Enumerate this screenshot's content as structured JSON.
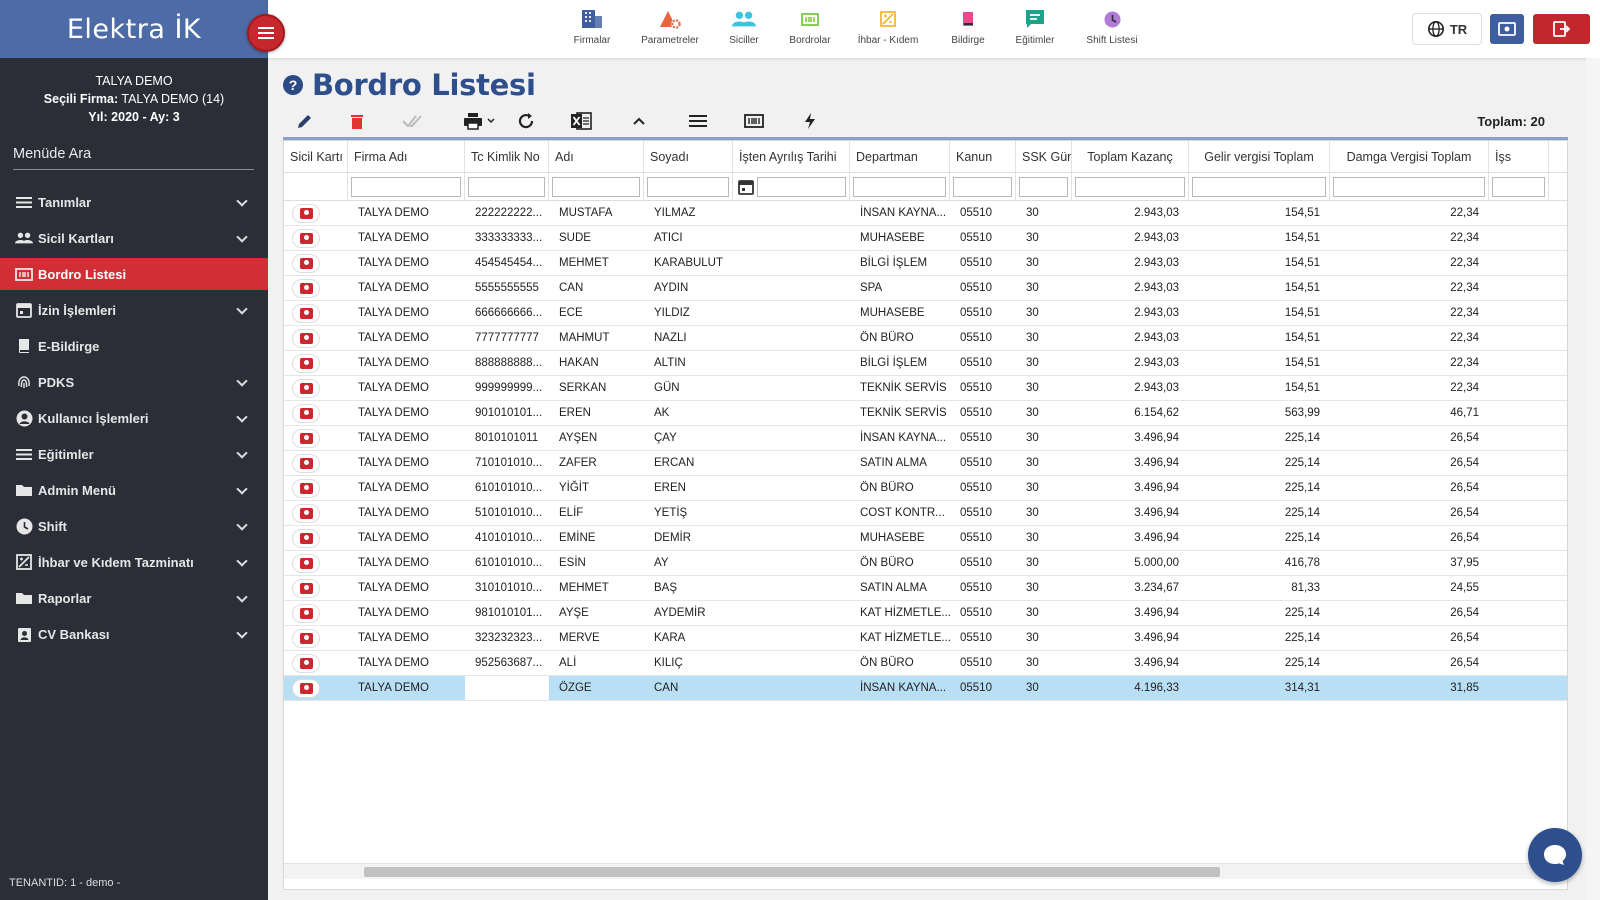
{
  "app": {
    "brand": "Elektra İK"
  },
  "company": {
    "name": "TALYA DEMO",
    "selected_label": "Seçili Firma:",
    "selected_value": "TALYA DEMO (14)",
    "period": "Yıl: 2020 - Ay: 3"
  },
  "sidebar": {
    "search_label": "Menüde Ara",
    "items": [
      {
        "label": "Tanımlar",
        "icon": "menu-icon"
      },
      {
        "label": "Sicil Kartları",
        "icon": "users-icon"
      },
      {
        "label": "Bordro Listesi",
        "icon": "payroll-icon"
      },
      {
        "label": "İzin İşlemleri",
        "icon": "calendar-icon"
      },
      {
        "label": "E-Bildirge",
        "icon": "book-icon"
      },
      {
        "label": "PDKS",
        "icon": "fingerprint-icon"
      },
      {
        "label": "Kullanıcı İşlemleri",
        "icon": "user-circle-icon"
      },
      {
        "label": "Eğitimler",
        "icon": "menu-icon"
      },
      {
        "label": "Admin Menü",
        "icon": "folder-icon"
      },
      {
        "label": "Shift",
        "icon": "clock-icon"
      },
      {
        "label": "İhbar ve Kıdem Tazminatı",
        "icon": "chart-box-icon"
      },
      {
        "label": "Raporlar",
        "icon": "folder-icon"
      },
      {
        "label": "CV Bankası",
        "icon": "badge-icon"
      }
    ],
    "tenant": "TENANTID: 1 - demo -"
  },
  "topbar": {
    "items": [
      {
        "label": "Firmalar",
        "icon": "building-icon",
        "color": "#3e5ea0"
      },
      {
        "label": "Parametreler",
        "icon": "shapes-icon",
        "color": "#e8663d"
      },
      {
        "label": "Siciller",
        "icon": "people-icon",
        "color": "#3cc3df"
      },
      {
        "label": "Bordrolar",
        "icon": "payroll-icon",
        "color": "#7ac943"
      },
      {
        "label": "İhbar - Kıdem",
        "icon": "chart-box-icon",
        "color": "#f5b731"
      },
      {
        "label": "Bildirge",
        "icon": "book-icon",
        "color": "#e84a8a"
      },
      {
        "label": "Eğitimler",
        "icon": "comment-icon",
        "color": "#1aa58a"
      },
      {
        "label": "Shift Listesi",
        "icon": "clock-icon",
        "color": "#b27ad6"
      }
    ],
    "lang": "TR"
  },
  "page": {
    "title": "Bordro Listesi",
    "total": "Toplam: 20"
  },
  "table": {
    "columns": [
      "Sicil Kartı",
      "Firma Adı",
      "Tc Kimlik No",
      "Adı",
      "Soyadı",
      "İşten Ayrılış Tarihi",
      "Departman",
      "Kanun",
      "SSK Gün",
      "Toplam Kazanç",
      "Gelir vergisi Toplam",
      "Damga Vergisi Toplam",
      "İşs"
    ],
    "rows": [
      [
        "TALYA DEMO",
        "222222222...",
        "MUSTAFA",
        "YILMAZ",
        "",
        "İNSAN KAYNA...",
        "05510",
        "30",
        "2.943,03",
        "154,51",
        "22,34"
      ],
      [
        "TALYA DEMO",
        "333333333...",
        "SUDE",
        "ATICI",
        "",
        "MUHASEBE",
        "05510",
        "30",
        "2.943,03",
        "154,51",
        "22,34"
      ],
      [
        "TALYA DEMO",
        "454545454...",
        "MEHMET",
        "KARABULUT",
        "",
        "BİLGİ İŞLEM",
        "05510",
        "30",
        "2.943,03",
        "154,51",
        "22,34"
      ],
      [
        "TALYA DEMO",
        "5555555555",
        "CAN",
        "AYDIN",
        "",
        "SPA",
        "05510",
        "30",
        "2.943,03",
        "154,51",
        "22,34"
      ],
      [
        "TALYA DEMO",
        "666666666...",
        "ECE",
        "YILDIZ",
        "",
        "MUHASEBE",
        "05510",
        "30",
        "2.943,03",
        "154,51",
        "22,34"
      ],
      [
        "TALYA DEMO",
        "7777777777",
        "MAHMUT",
        "NAZLI",
        "",
        "ÖN BÜRO",
        "05510",
        "30",
        "2.943,03",
        "154,51",
        "22,34"
      ],
      [
        "TALYA DEMO",
        "888888888...",
        "HAKAN",
        "ALTIN",
        "",
        "BİLGİ İŞLEM",
        "05510",
        "30",
        "2.943,03",
        "154,51",
        "22,34"
      ],
      [
        "TALYA DEMO",
        "999999999...",
        "SERKAN",
        "GÜN",
        "",
        "TEKNİK SERVİS",
        "05510",
        "30",
        "2.943,03",
        "154,51",
        "22,34"
      ],
      [
        "TALYA DEMO",
        "901010101...",
        "EREN",
        "AK",
        "",
        "TEKNİK SERVİS",
        "05510",
        "30",
        "6.154,62",
        "563,99",
        "46,71"
      ],
      [
        "TALYA DEMO",
        "8010101011",
        "AYŞEN",
        "ÇAY",
        "",
        "İNSAN KAYNA...",
        "05510",
        "30",
        "3.496,94",
        "225,14",
        "26,54"
      ],
      [
        "TALYA DEMO",
        "710101010...",
        "ZAFER",
        "ERCAN",
        "",
        "SATIN ALMA",
        "05510",
        "30",
        "3.496,94",
        "225,14",
        "26,54"
      ],
      [
        "TALYA DEMO",
        "610101010...",
        "YİĞİT",
        "EREN",
        "",
        "ÖN BÜRO",
        "05510",
        "30",
        "3.496,94",
        "225,14",
        "26,54"
      ],
      [
        "TALYA DEMO",
        "510101010...",
        "ELİF",
        "YETİŞ",
        "",
        "COST KONTR...",
        "05510",
        "30",
        "3.496,94",
        "225,14",
        "26,54"
      ],
      [
        "TALYA DEMO",
        "410101010...",
        "EMİNE",
        "DEMİR",
        "",
        "MUHASEBE",
        "05510",
        "30",
        "3.496,94",
        "225,14",
        "26,54"
      ],
      [
        "TALYA DEMO",
        "610101010...",
        "ESİN",
        "AY",
        "",
        "ÖN BÜRO",
        "05510",
        "30",
        "5.000,00",
        "416,78",
        "37,95"
      ],
      [
        "TALYA DEMO",
        "310101010...",
        "MEHMET",
        "BAŞ",
        "",
        "SATIN ALMA",
        "05510",
        "30",
        "3.234,67",
        "81,33",
        "24,55"
      ],
      [
        "TALYA DEMO",
        "981010101...",
        "AYŞE",
        "AYDEMİR",
        "",
        "KAT HİZMETLE...",
        "05510",
        "30",
        "3.496,94",
        "225,14",
        "26,54"
      ],
      [
        "TALYA DEMO",
        "323232323...",
        "MERVE",
        "KARA",
        "",
        "KAT HİZMETLE...",
        "05510",
        "30",
        "3.496,94",
        "225,14",
        "26,54"
      ],
      [
        "TALYA DEMO",
        "952563687...",
        "ALİ",
        "KILIÇ",
        "",
        "ÖN BÜRO",
        "05510",
        "30",
        "3.496,94",
        "225,14",
        "26,54"
      ],
      [
        "TALYA DEMO",
        "",
        "ÖZGE",
        "CAN",
        "",
        "İNSAN KAYNA...",
        "05510",
        "30",
        "4.196,33",
        "314,31",
        "31,85"
      ]
    ],
    "selected_row": 19
  },
  "colors": {
    "sidebar": "#2b2e37",
    "brand": "#4d6ba6",
    "active": "#d12f35",
    "title": "#2e4f8c",
    "selected": "#b9dff5"
  }
}
